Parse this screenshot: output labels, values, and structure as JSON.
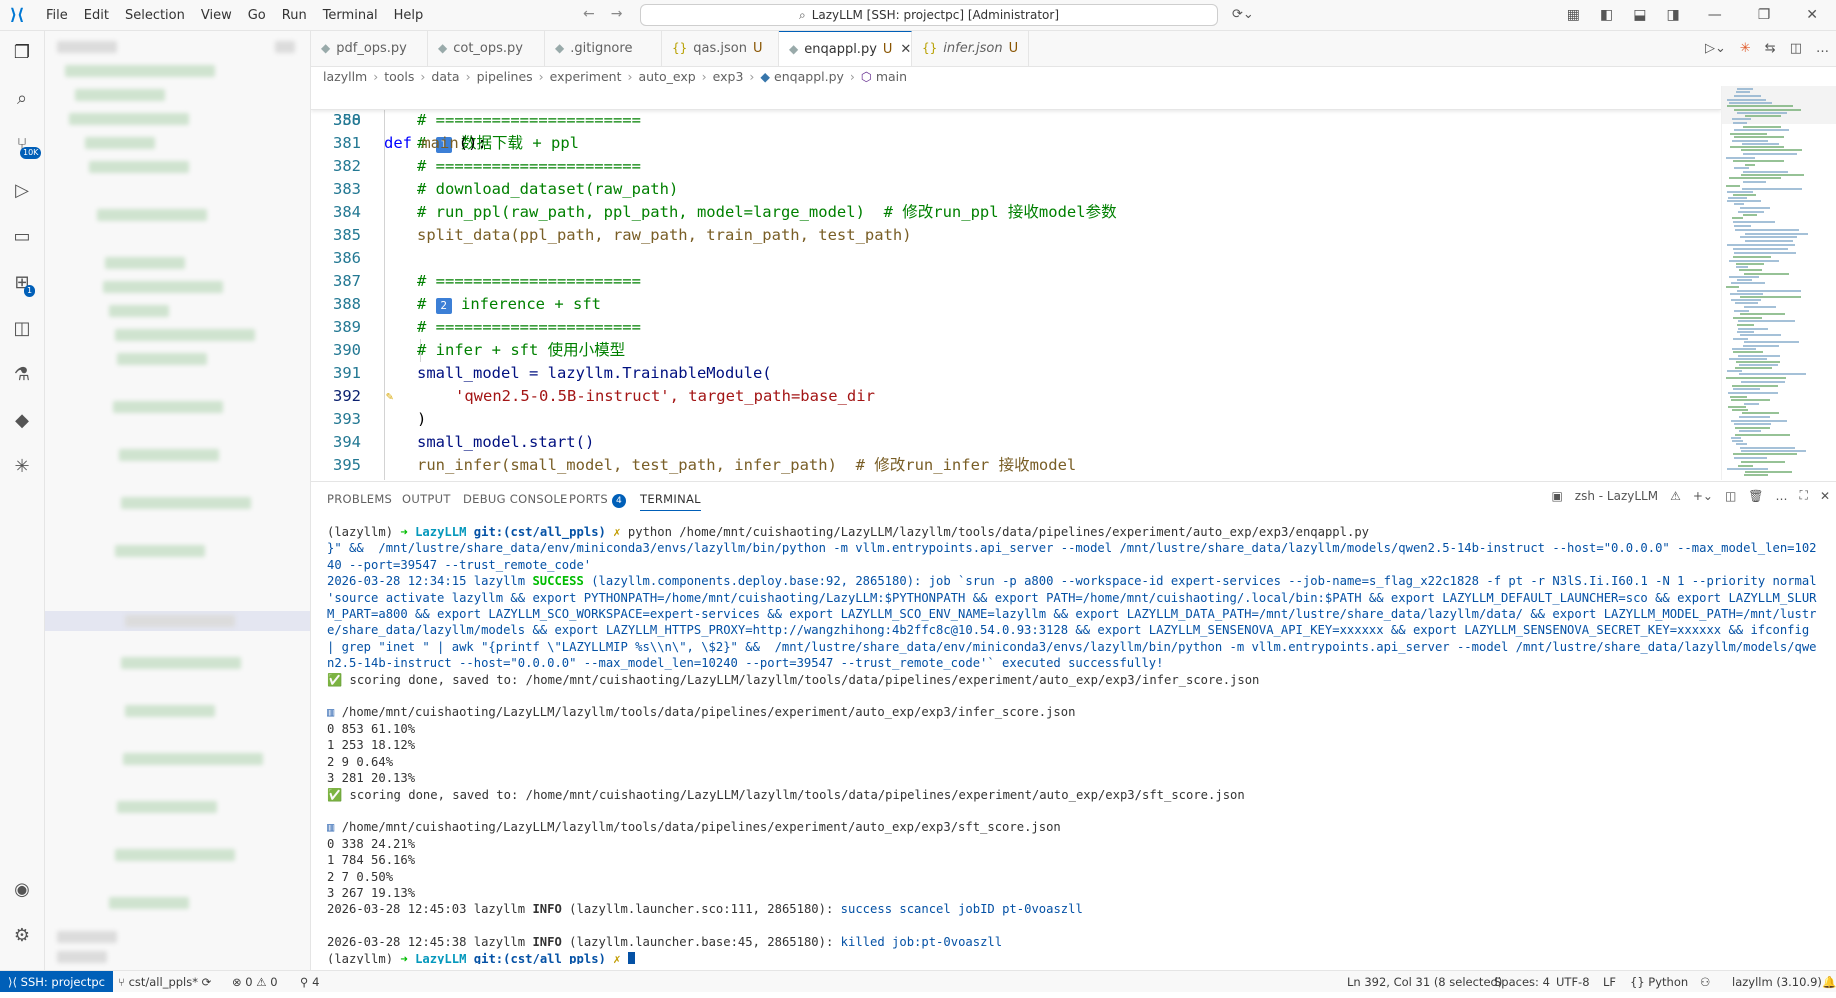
{
  "menu": [
    "File",
    "Edit",
    "Selection",
    "View",
    "Go",
    "Run",
    "Terminal",
    "Help"
  ],
  "search": {
    "text": "LazyLLM [SSH: projectpc] [Administrator]"
  },
  "tabs": [
    {
      "label": "pdf_ops.py",
      "icon": "python-file-icon",
      "mod": ""
    },
    {
      "label": "cot_ops.py",
      "icon": "python-file-icon",
      "mod": ""
    },
    {
      "label": ".gitignore",
      "icon": "git-file-icon",
      "mod": ""
    },
    {
      "label": "qas.json",
      "icon": "json-file-icon",
      "mod": "U"
    },
    {
      "label": "enqappl.py",
      "icon": "python-file-icon",
      "mod": "U"
    },
    {
      "label": "infer.json",
      "icon": "json-file-icon",
      "mod": "U"
    }
  ],
  "breadcrumb": [
    "lazyllm",
    "tools",
    "data",
    "pipelines",
    "experiment",
    "auto_exp",
    "exp3",
    "enqappl.py",
    "main"
  ],
  "code": {
    "sticky": {
      "ln": "358",
      "text": "def main():"
    },
    "lines": [
      {
        "ln": "380",
        "text": "# ======================"
      },
      {
        "ln": "381",
        "badge": "1",
        "text": "数据下载 + ppl"
      },
      {
        "ln": "382",
        "text": "# ======================"
      },
      {
        "ln": "383",
        "text": "# download_dataset(raw_path)"
      },
      {
        "ln": "384",
        "text": "# run_ppl(raw_path, ppl_path, model=large_model)  # 修改run_ppl 接收model参数"
      },
      {
        "ln": "385",
        "text": "split_data(ppl_path, raw_path, train_path, test_path)"
      },
      {
        "ln": "386",
        "text": ""
      },
      {
        "ln": "387",
        "text": "# ======================"
      },
      {
        "ln": "388",
        "badge": "2",
        "text": "inference + sft"
      },
      {
        "ln": "389",
        "text": "# ======================"
      },
      {
        "ln": "390",
        "text": "# infer + sft 使用小模型"
      },
      {
        "ln": "391",
        "text": "small_model = lazyllm.TrainableModule("
      },
      {
        "ln": "392",
        "text": "'qwen2.5-0.5B-instruct', target_path=base_dir"
      },
      {
        "ln": "393",
        "text": ")"
      },
      {
        "ln": "394",
        "text": "small_model.start()"
      },
      {
        "ln": "395",
        "text": "run_infer(small_model, test_path, infer_path)  # 修改run_infer 接收model"
      }
    ]
  },
  "panel": {
    "tabs": [
      "PROBLEMS",
      "OUTPUT",
      "DEBUG CONSOLE",
      "PORTS",
      "TERMINAL"
    ],
    "ports_count": "4",
    "terminal_name": "zsh - LazyLLM"
  },
  "terminal": {
    "prompt_env": "(lazyllm)",
    "prompt_dir": "LazyLLM",
    "prompt_git": "git:(cst/all_ppls)",
    "cmd": "python /home/mnt/cuishaoting/LazyLLM/lazyllm/tools/data/pipelines/experiment/auto_exp/exp3/enqappl.py",
    "line2": "}\" &&  /mnt/lustre/share_data/env/miniconda3/envs/lazyllm/bin/python -m vllm.entrypoints.api_server --model /mnt/lustre/share_data/lazyllm/models/qwen2.5-14b-instruct --host=\"0.0.0.0\" --max_model_len=10240 --port=39547 --trust_remote_code'",
    "success_ts": "2026-03-28 12:34:15 lazyllm",
    "success_tag": "SUCCESS",
    "success_msg": "(lazyllm.components.deploy.base:92, 2865180): job `srun -p a800 --workspace-id expert-services --job-name=s_flag_x22c1828 -f pt -r N3lS.Ii.I60.1 -N 1 --priority normal  'source activate lazyllm && export PYTHONPATH=/home/mnt/cuishaoting/LazyLLM:$PYTHONPATH && export PATH=/home/mnt/cuishaoting/.local/bin:$PATH && export LAZYLLM_DEFAULT_LAUNCHER=sco && export LAZYLLM_SLURM_PART=a800 && export LAZYLLM_SCO_WORKSPACE=expert-services && export LAZYLLM_SCO_ENV_NAME=lazyllm && export LAZYLLM_DATA_PATH=/mnt/lustre/share_data/lazyllm/data/ && export LAZYLLM_MODEL_PATH=/mnt/lustre/share_data/lazyllm/models && export LAZYLLM_HTTPS_PROXY=http://wangzhihong:4b2ffc8c@10.54.0.93:3128 && export LAZYLLM_SENSENOVA_API_KEY=xxxxxx && export LAZYLLM_SENSENOVA_SECRET_KEY=xxxxxx && ifconfig | grep \"inet \" | awk \"{printf \\\"LAZYLLMIP %s\\\\n\\\", \\$2}\" &&  /mnt/lustre/share_data/env/miniconda3/envs/lazyllm/bin/python -m vllm.entrypoints.api_server --model /mnt/lustre/share_data/lazyllm/models/qwen2.5-14b-instruct --host=\"0.0.0.0\" --max_model_len=10240 --port=39547 --trust_remote_code'` executed successfully!",
    "score1_done": "scoring done, saved to: /home/mnt/cuishaoting/LazyLLM/lazyllm/tools/data/pipelines/experiment/auto_exp/exp3/infer_score.json",
    "score1_path": "/home/mnt/cuishaoting/LazyLLM/lazyllm/tools/data/pipelines/experiment/auto_exp/exp3/infer_score.json",
    "score1_rows": [
      "0 853 61.10%",
      "1 253 18.12%",
      "2 9 0.64%",
      "3 281 20.13%"
    ],
    "score2_done": "scoring done, saved to: /home/mnt/cuishaoting/LazyLLM/lazyllm/tools/data/pipelines/experiment/auto_exp/exp3/sft_score.json",
    "score2_path": "/home/mnt/cuishaoting/LazyLLM/lazyllm/tools/data/pipelines/experiment/auto_exp/exp3/sft_score.json",
    "score2_rows": [
      "0 338 24.21%",
      "1 784 56.16%",
      "2 7 0.50%",
      "3 267 19.13%"
    ],
    "info1_ts": "2026-03-28 12:45:03 lazyllm",
    "info1_tag": "INFO",
    "info1_src": "(lazyllm.launcher.sco:111, 2865180):",
    "info1_msg": "success scancel jobID pt-0voaszll",
    "info2_ts": "2026-03-28 12:45:38 lazyllm",
    "info2_tag": "INFO",
    "info2_src": "(lazyllm.launcher.base:45, 2865180):",
    "info2_msg": "killed job:pt-0voaszll"
  },
  "status": {
    "remote": "SSH: projectpc",
    "branch": "cst/all_ppls*",
    "problems": "0 ⚠ 0",
    "ports": "4",
    "position": "Ln 392, Col 31 (8 selected)",
    "spaces": "Spaces: 4",
    "encoding": "UTF-8",
    "eol": "LF",
    "language": "Python",
    "interpreter": "lazyllm (3.10.9)"
  },
  "colors": {
    "accent": "#005fb8",
    "success": "#00bc00",
    "comment": "#008000"
  }
}
